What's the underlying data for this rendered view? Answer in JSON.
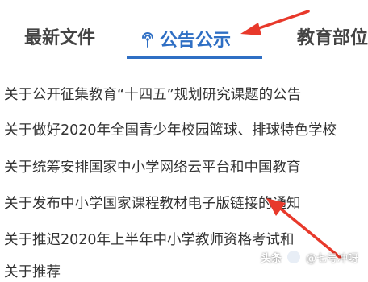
{
  "tabs": [
    {
      "label": "最新文件",
      "active": false
    },
    {
      "label": "公告公示",
      "active": true,
      "icon": "signal-icon"
    },
    {
      "label": "教育部位",
      "active": false
    }
  ],
  "active_color": "#2f6fc4",
  "notices": [
    "关于公开征集教育“十四五”规划研究课题的公告",
    "关于做好2020年全国青少年校园篮球、排球特色学校",
    "关于统筹安排国家中小学网络云平台和中国教育",
    "关于发布中小学国家课程教材电子版链接的通知",
    "关于推迟2020年上半年中小学教师资格考试和",
    "关于推荐"
  ],
  "annotation_color": "#e8392b",
  "watermark": {
    "brand": "头条",
    "author": "@七号冲呀"
  }
}
